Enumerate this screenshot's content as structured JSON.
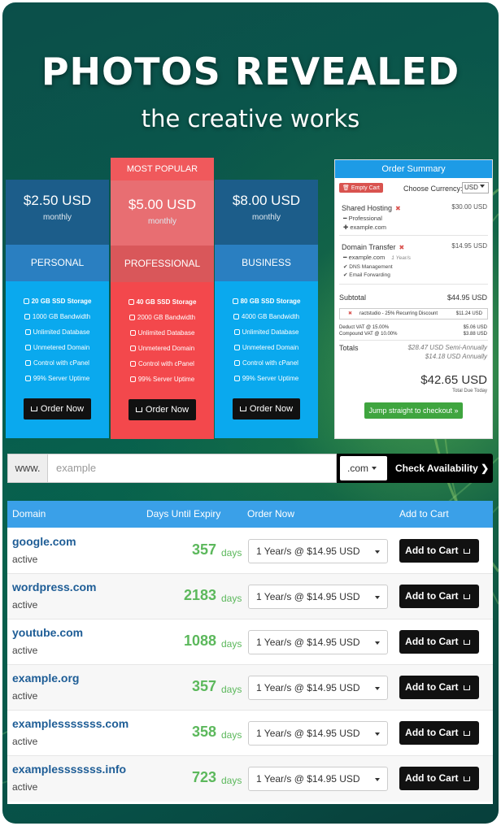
{
  "hero": {
    "title": "PHOTOS REVEALED",
    "subtitle": "the creative works"
  },
  "pricing": {
    "popular_label": "MOST POPULAR",
    "order_label": "Order Now",
    "plans": [
      {
        "price": "$2.50 USD",
        "period": "monthly",
        "name": "PERSONAL",
        "features": [
          "20 GB SSD Storage",
          "1000 GB Bandwidth",
          "Unlimited Database",
          "Unmetered Domain",
          "Control with cPanel",
          "99% Server Uptime"
        ]
      },
      {
        "price": "$5.00 USD",
        "period": "monthly",
        "name": "PROFESSIONAL",
        "features": [
          "40 GB SSD Storage",
          "2000 GB Bandwidth",
          "Unlimited Database",
          "Unmetered Domain",
          "Control with cPanel",
          "99% Server Uptime"
        ]
      },
      {
        "price": "$8.00 USD",
        "period": "monthly",
        "name": "BUSINESS",
        "features": [
          "80 GB SSD Storage",
          "4000 GB Bandwidth",
          "Unlimited Database",
          "Unmetered Domain",
          "Control with cPanel",
          "99% Server Uptime"
        ]
      }
    ]
  },
  "summary": {
    "title": "Order Summary",
    "empty_cart": "Empty Cart",
    "currency_label": "Choose Currency:",
    "currency_value": "USD",
    "items": [
      {
        "title": "Shared Hosting",
        "price": "$30.00 USD",
        "sub": [
          "━ Professional",
          "✚ example.com"
        ]
      },
      {
        "title": "Domain Transfer",
        "price": "$14.95 USD",
        "sub": [
          "━ example.com",
          "✔ DNS Management",
          "✔ Email Forwarding"
        ],
        "term": "1 Year/s"
      }
    ],
    "subtotal_label": "Subtotal",
    "subtotal_value": "$44.95 USD",
    "discount_label": "ractstudio - 25% Recurring Discount",
    "discount_value": "$11.24 USD",
    "vat1_label": "Deduct VAT @ 15.00%",
    "vat1_value": "$5.06 USD",
    "vat2_label": "Compound VAT @ 10.00%",
    "vat2_value": "$3.88 USD",
    "totals_label": "Totals",
    "totals_semi": "$28.47 USD Semi-Annually",
    "totals_annual": "$14.18 USD Annually",
    "grand_total": "$42.65 USD",
    "due_label": "Total Due Today",
    "checkout_label": "Jump straight to checkout »"
  },
  "search": {
    "prefix": "www.",
    "placeholder": "example",
    "tld": ".com",
    "button": "Check Availability"
  },
  "table": {
    "headers": [
      "Domain",
      "Days Until Expiry",
      "Order Now",
      "Add to Cart"
    ],
    "days_unit": "days",
    "add_label": "Add to Cart",
    "rows": [
      {
        "domain": "google.com",
        "status": "active",
        "days": "357",
        "period": "1 Year/s @ $14.95 USD"
      },
      {
        "domain": "wordpress.com",
        "status": "active",
        "days": "2183",
        "period": "1 Year/s @ $14.95 USD"
      },
      {
        "domain": "youtube.com",
        "status": "active",
        "days": "1088",
        "period": "1 Year/s @ $14.95 USD"
      },
      {
        "domain": "example.org",
        "status": "active",
        "days": "357",
        "period": "1 Year/s @ $14.95 USD"
      },
      {
        "domain": "examplesssssss.com",
        "status": "active",
        "days": "358",
        "period": "1 Year/s @ $14.95 USD"
      },
      {
        "domain": "examplesssssss.info",
        "status": "active",
        "days": "723",
        "period": "1 Year/s @ $14.95 USD"
      }
    ]
  }
}
